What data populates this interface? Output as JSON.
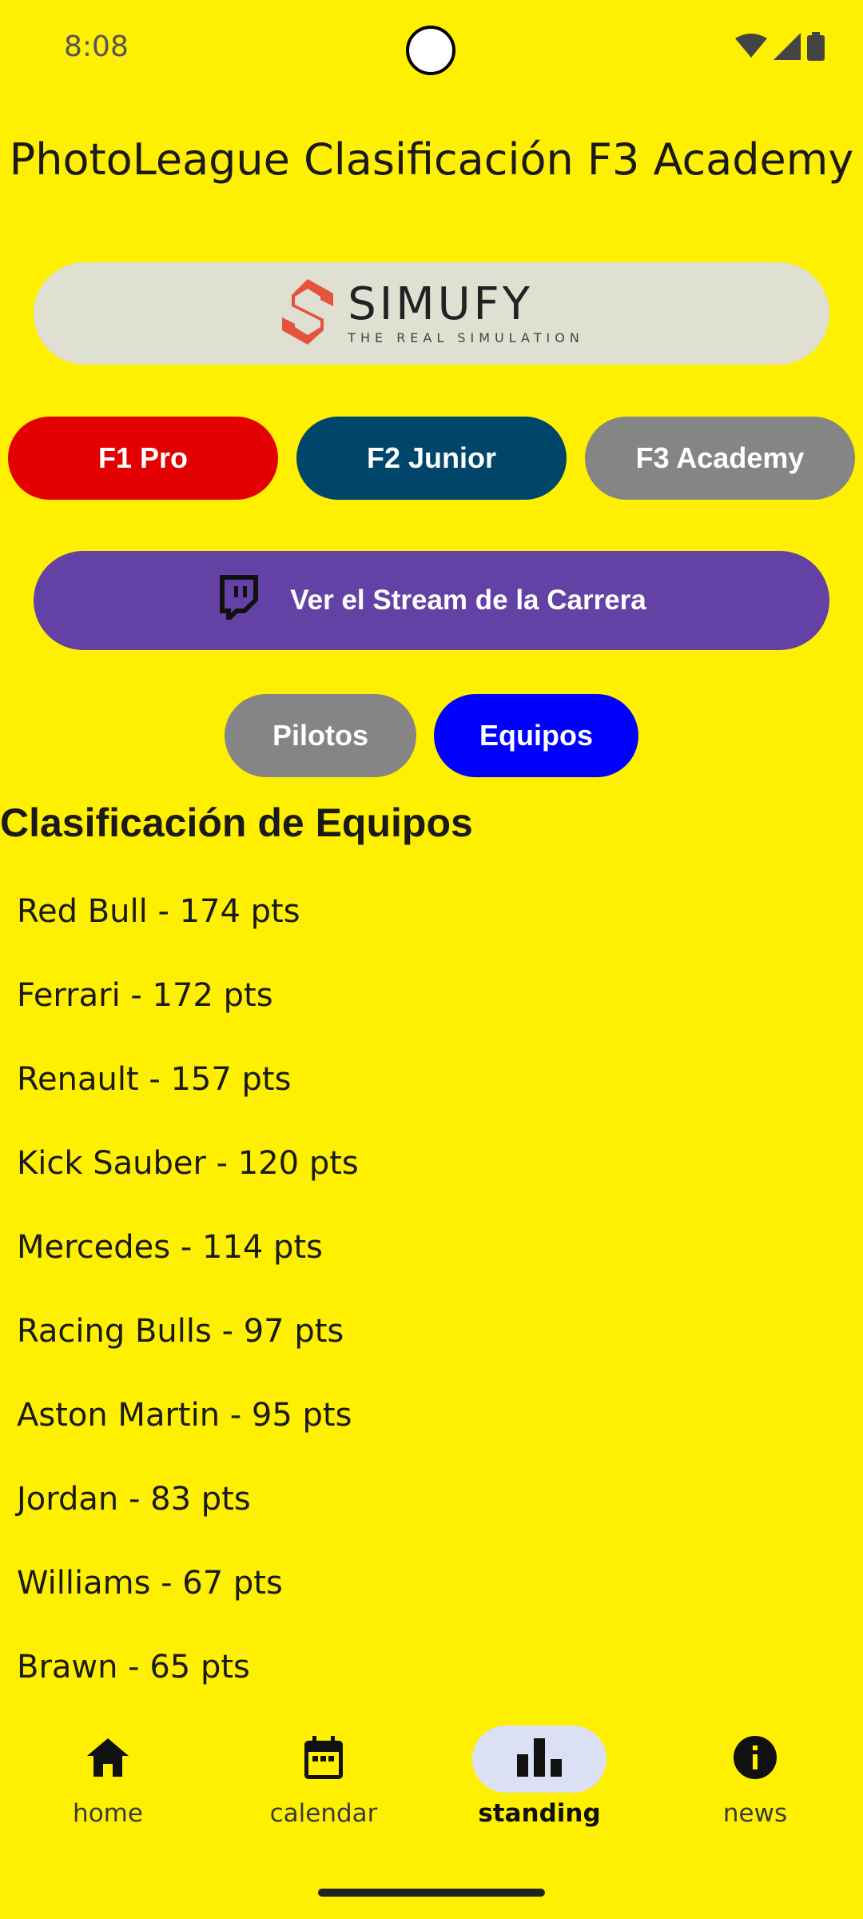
{
  "status_bar": {
    "time": "8:08",
    "icons": [
      "wifi-icon",
      "cell-signal-icon",
      "battery-icon"
    ]
  },
  "app": {
    "title": "PhotoLeague Clasificación F3 Academy"
  },
  "sponsor": {
    "name": "SIMUFY",
    "tagline": "THE REAL SIMULATION",
    "logo_color": "#E5533D"
  },
  "categories": [
    {
      "label": "F1 Pro",
      "color": "#E30000"
    },
    {
      "label": "F2 Junior",
      "color": "#00456A"
    },
    {
      "label": "F3 Academy",
      "color": "#858585"
    }
  ],
  "stream": {
    "label": "Ver el Stream de la Carrera",
    "icon": "twitch-icon",
    "color": "#6441A5"
  },
  "view_toggle": {
    "pilotos": {
      "label": "Pilotos",
      "color": "#858585"
    },
    "equipos": {
      "label": "Equipos",
      "color": "#0000FF"
    }
  },
  "standings": {
    "title": "Clasificación de Equipos",
    "items": [
      "Red Bull - 174 pts",
      "Ferrari - 172 pts",
      "Renault - 157 pts",
      "Kick Sauber - 120 pts",
      "Mercedes - 114 pts",
      "Racing Bulls - 97 pts",
      "Aston Martin - 95 pts",
      "Jordan - 83 pts",
      "Williams - 67 pts",
      "Brawn - 65 pts"
    ]
  },
  "bottom_nav": {
    "items": [
      {
        "label": "home",
        "icon": "home-icon"
      },
      {
        "label": "calendar",
        "icon": "calendar-icon"
      },
      {
        "label": "standing",
        "icon": "bar-chart-icon",
        "active": true
      },
      {
        "label": "news",
        "icon": "info-icon"
      }
    ]
  },
  "colors": {
    "background": "#FFEF00",
    "nav_active_pill": "#DCE0F4"
  }
}
